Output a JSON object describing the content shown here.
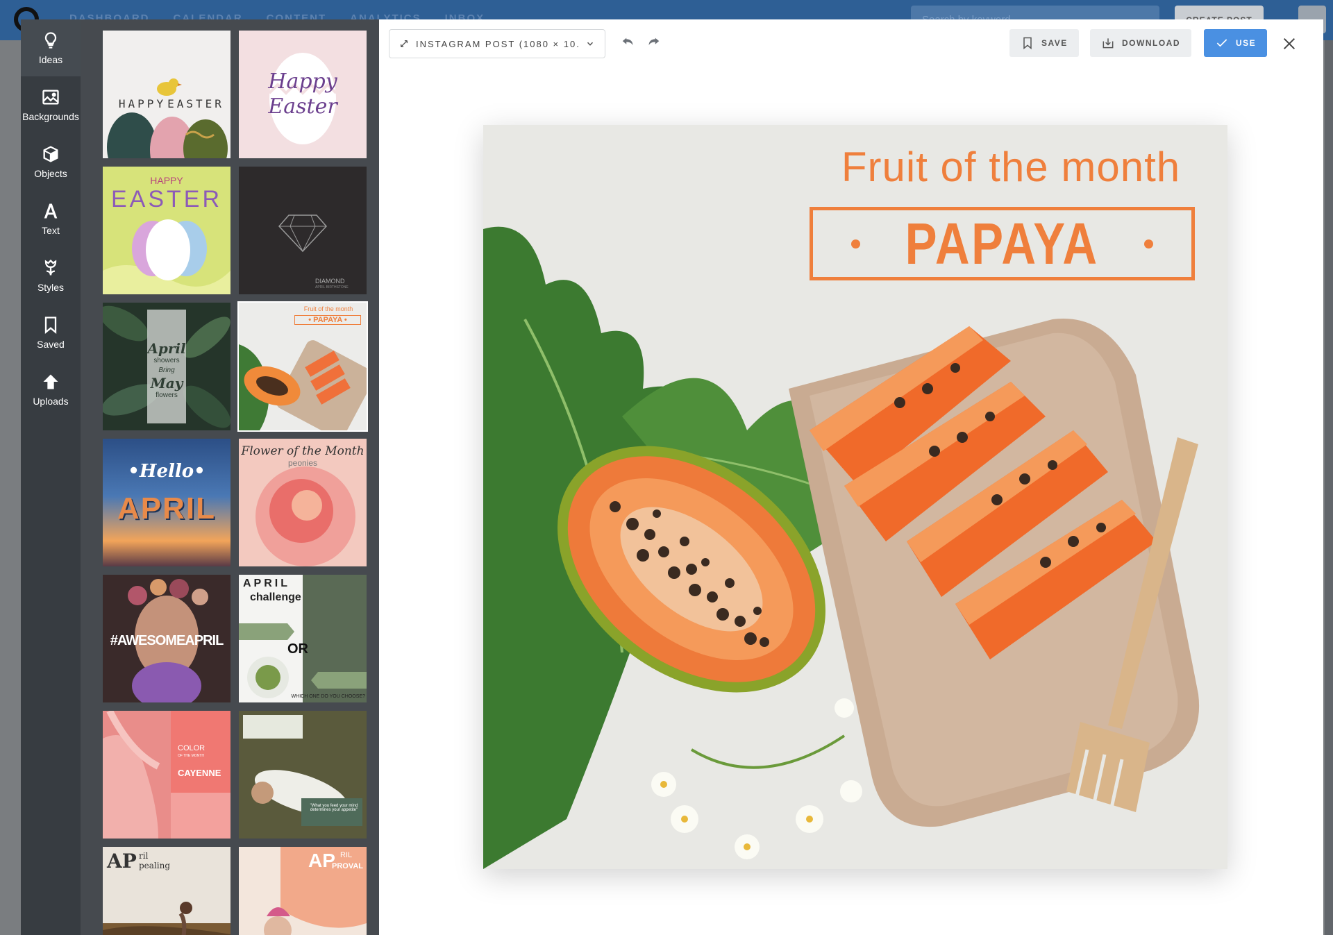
{
  "background_app": {
    "nav_links": [
      "DASHBOARD",
      "CALENDAR",
      "CONTENT",
      "ANALYTICS",
      "INBOX"
    ],
    "search_placeholder": "Search by keyword",
    "create_label": "CREATE POST"
  },
  "tools": [
    {
      "label": "Ideas",
      "icon": "lightbulb-icon"
    },
    {
      "label": "Backgrounds",
      "icon": "image-icon"
    },
    {
      "label": "Objects",
      "icon": "cube-icon"
    },
    {
      "label": "Text",
      "icon": "text-a-icon"
    },
    {
      "label": "Styles",
      "icon": "tulip-icon"
    },
    {
      "label": "Saved",
      "icon": "bookmark-icon"
    },
    {
      "label": "Uploads",
      "icon": "upload-arrow-icon"
    }
  ],
  "templates": {
    "t1": {
      "a": "HAPPY",
      "b": "EASTER"
    },
    "t2": {
      "a": "Happy",
      "b": "Easter"
    },
    "t3": {
      "a": "HAPPY",
      "b": "EASTER"
    },
    "t4": {
      "a": "DIAMOND",
      "b": "APRIL BIRTHSTONE"
    },
    "t5": {
      "a": "April",
      "b": "showers",
      "c": "Bring",
      "d": "May",
      "e": "flowers"
    },
    "t6": {
      "a": "Fruit of the month",
      "b": "• PAPAYA •"
    },
    "t7": {
      "a": "•Hello•",
      "b": "APRIL"
    },
    "t8": {
      "a": "Flower of the Month",
      "b": "peonies"
    },
    "t9": {
      "a": "#AWESOMEAPRIL"
    },
    "t10": {
      "a": "APRIL",
      "b": "challenge",
      "c": "OR",
      "d": "WHICH ONE DO YOU CHOOSE?"
    },
    "t11": {
      "a": "COLOR",
      "b": "OF THE MONTH",
      "c": "CAYENNE"
    },
    "t12": {
      "a": "\"What you feed your mind determines your appetite\""
    },
    "t13": {
      "a": "AP",
      "b": "ril",
      "c": "pealing"
    },
    "t14": {
      "a": "AP",
      "b": "RIL",
      "c": "PROVAL"
    }
  },
  "toolbar": {
    "size_label": "INSTAGRAM POST (1080 × 10...",
    "save_label": "SAVE",
    "download_label": "DOWNLOAD",
    "use_label": "USE"
  },
  "canvas": {
    "title": "Fruit of the month",
    "name": "PAPAYA"
  },
  "colors": {
    "accent": "#4a90e2",
    "brand_orange": "#ef7f3c",
    "sidebar": "#373c41",
    "panel": "#464a4f"
  }
}
